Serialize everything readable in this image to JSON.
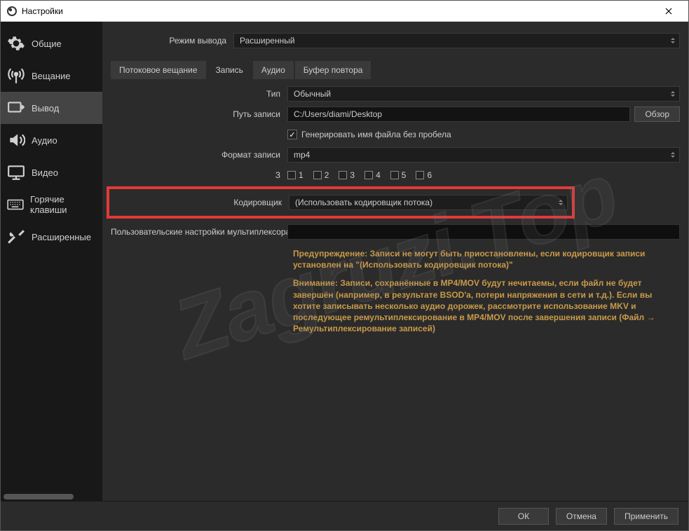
{
  "titlebar": {
    "title": "Настройки"
  },
  "sidebar": {
    "items": [
      {
        "label": "Общие",
        "icon": "gear-icon"
      },
      {
        "label": "Вещание",
        "icon": "antenna-icon"
      },
      {
        "label": "Вывод",
        "icon": "output-icon"
      },
      {
        "label": "Аудио",
        "icon": "speaker-icon"
      },
      {
        "label": "Видео",
        "icon": "monitor-icon"
      },
      {
        "label": "Горячие клавиши",
        "icon": "keyboard-icon"
      },
      {
        "label": "Расширенные",
        "icon": "tools-icon"
      }
    ],
    "active_index": 2
  },
  "output_mode": {
    "label": "Режим вывода",
    "value": "Расширенный"
  },
  "tabs": {
    "items": [
      "Потоковое вещание",
      "Запись",
      "Аудио",
      "Буфер повтора"
    ],
    "active_index": 1
  },
  "form": {
    "type_label": "Тип",
    "type_value": "Обычный",
    "path_label": "Путь записи",
    "path_value": "C:/Users/diami/Desktop",
    "browse_label": "Обзор",
    "gen_filename_label": "Генерировать имя файла без пробела",
    "format_label": "Формат записи",
    "format_value": "mp4",
    "tracks_label": "З",
    "tracks": [
      "1",
      "2",
      "3",
      "4",
      "5",
      "6"
    ],
    "encoder_label": "Кодировщик",
    "encoder_value": "(Использовать кодировщик потока)",
    "muxer_label": "Пользовательские настройки мультиплексора"
  },
  "warnings": {
    "w1": "Предупреждение: Записи не могут быть приостановлены, если кодировщик записи установлен на \"(Использовать кодировщик потока)\"",
    "w2": "Внимание: Записи, сохранённые в MP4/MOV будут нечитаемы, если файл не будет завершён (например, в результате BSOD'а, потери напряжения в сети и т.д.). Если вы хотите записывать несколько аудио дорожек, рассмотрите использование MKV и последующее ремультиплексирование в MP4/MOV после завершения записи (Файл → Ремультиплексирование записей)"
  },
  "footer": {
    "ok": "ОК",
    "cancel": "Отмена",
    "apply": "Применить"
  },
  "watermark": "Zagruzi.Top"
}
